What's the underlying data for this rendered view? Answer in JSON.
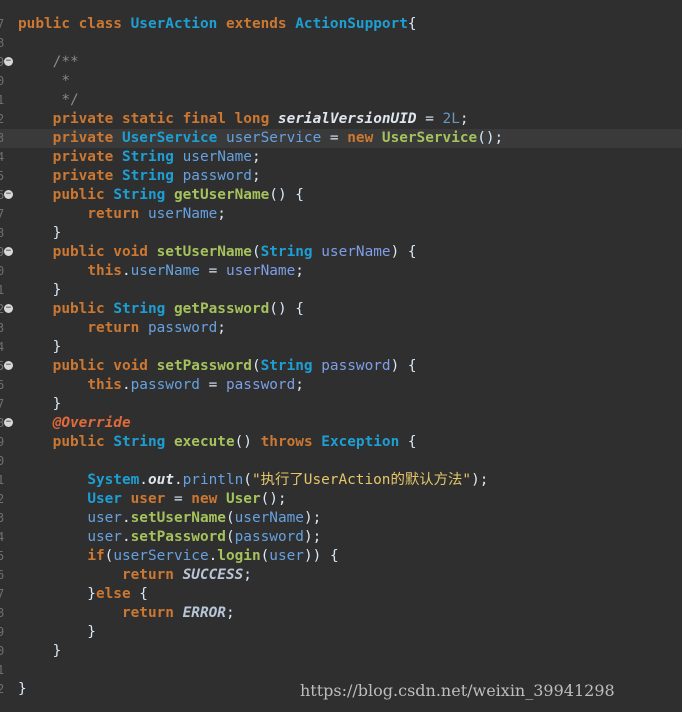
{
  "editor": {
    "lines": [
      {
        "ln": "7",
        "fold": false,
        "hl": false,
        "t": [
          [
            "kw",
            "public class "
          ],
          [
            "ty",
            "UserAction "
          ],
          [
            "kw",
            "extends "
          ],
          [
            "ty",
            "ActionSupport"
          ],
          [
            "pl",
            "{"
          ]
        ]
      },
      {
        "ln": "8",
        "fold": false,
        "hl": false,
        "t": []
      },
      {
        "ln": "9",
        "fold": true,
        "hl": false,
        "t": [
          [
            "pl",
            "    "
          ],
          [
            "cm",
            "/**"
          ]
        ]
      },
      {
        "ln": "0",
        "fold": false,
        "hl": false,
        "t": [
          [
            "pl",
            "    "
          ],
          [
            "cm",
            " *"
          ]
        ]
      },
      {
        "ln": "1",
        "fold": false,
        "hl": false,
        "t": [
          [
            "pl",
            "    "
          ],
          [
            "cm",
            " */"
          ]
        ]
      },
      {
        "ln": "2",
        "fold": false,
        "hl": false,
        "t": [
          [
            "pl",
            "    "
          ],
          [
            "kw",
            "private static final long "
          ],
          [
            "sti",
            "serialVersionUID"
          ],
          [
            "pl",
            " = "
          ],
          [
            "num",
            "2L"
          ],
          [
            "pl",
            ";"
          ]
        ]
      },
      {
        "ln": "3",
        "fold": false,
        "hl": true,
        "t": [
          [
            "pl",
            "    "
          ],
          [
            "kw",
            "private "
          ],
          [
            "ty",
            "UserService "
          ],
          [
            "fld",
            "userService"
          ],
          [
            "pl",
            " = "
          ],
          [
            "kw",
            "new "
          ],
          [
            "fn",
            "UserService"
          ],
          [
            "pl",
            "();"
          ]
        ]
      },
      {
        "ln": "4",
        "fold": false,
        "hl": false,
        "t": [
          [
            "pl",
            "    "
          ],
          [
            "kw",
            "private "
          ],
          [
            "ty",
            "String "
          ],
          [
            "fld",
            "userName"
          ],
          [
            "pl",
            ";"
          ]
        ]
      },
      {
        "ln": "5",
        "fold": false,
        "hl": false,
        "t": [
          [
            "pl",
            "    "
          ],
          [
            "kw",
            "private "
          ],
          [
            "ty",
            "String "
          ],
          [
            "fld",
            "password"
          ],
          [
            "pl",
            ";"
          ]
        ]
      },
      {
        "ln": "6",
        "fold": true,
        "hl": false,
        "t": [
          [
            "pl",
            "    "
          ],
          [
            "kw",
            "public "
          ],
          [
            "ty",
            "String "
          ],
          [
            "fn",
            "getUserName"
          ],
          [
            "pl",
            "() {"
          ]
        ]
      },
      {
        "ln": "7",
        "fold": false,
        "hl": false,
        "t": [
          [
            "pl",
            "        "
          ],
          [
            "kw",
            "return "
          ],
          [
            "fld",
            "userName"
          ],
          [
            "pl",
            ";"
          ]
        ]
      },
      {
        "ln": "8",
        "fold": false,
        "hl": false,
        "t": [
          [
            "pl",
            "    }"
          ]
        ]
      },
      {
        "ln": "9",
        "fold": true,
        "hl": false,
        "t": [
          [
            "pl",
            "    "
          ],
          [
            "kw",
            "public void "
          ],
          [
            "fn",
            "setUserName"
          ],
          [
            "pl",
            "("
          ],
          [
            "ty",
            "String "
          ],
          [
            "prm",
            "userName"
          ],
          [
            "pl",
            ") {"
          ]
        ]
      },
      {
        "ln": "0",
        "fold": false,
        "hl": false,
        "t": [
          [
            "pl",
            "        "
          ],
          [
            "kw",
            "this"
          ],
          [
            "pl",
            "."
          ],
          [
            "fld",
            "userName"
          ],
          [
            "pl",
            " = "
          ],
          [
            "prm",
            "userName"
          ],
          [
            "pl",
            ";"
          ]
        ]
      },
      {
        "ln": "1",
        "fold": false,
        "hl": false,
        "t": [
          [
            "pl",
            "    }"
          ]
        ]
      },
      {
        "ln": "2",
        "fold": true,
        "hl": false,
        "t": [
          [
            "pl",
            "    "
          ],
          [
            "kw",
            "public "
          ],
          [
            "ty",
            "String "
          ],
          [
            "fn",
            "getPassword"
          ],
          [
            "pl",
            "() {"
          ]
        ]
      },
      {
        "ln": "3",
        "fold": false,
        "hl": false,
        "t": [
          [
            "pl",
            "        "
          ],
          [
            "kw",
            "return "
          ],
          [
            "fld",
            "password"
          ],
          [
            "pl",
            ";"
          ]
        ]
      },
      {
        "ln": "4",
        "fold": false,
        "hl": false,
        "t": [
          [
            "pl",
            "    }"
          ]
        ]
      },
      {
        "ln": "5",
        "fold": true,
        "hl": false,
        "t": [
          [
            "pl",
            "    "
          ],
          [
            "kw",
            "public void "
          ],
          [
            "fn",
            "setPassword"
          ],
          [
            "pl",
            "("
          ],
          [
            "ty",
            "String "
          ],
          [
            "prm",
            "password"
          ],
          [
            "pl",
            ") {"
          ]
        ]
      },
      {
        "ln": "6",
        "fold": false,
        "hl": false,
        "t": [
          [
            "pl",
            "        "
          ],
          [
            "kw",
            "this"
          ],
          [
            "pl",
            "."
          ],
          [
            "fld",
            "password"
          ],
          [
            "pl",
            " = "
          ],
          [
            "prm",
            "password"
          ],
          [
            "pl",
            ";"
          ]
        ]
      },
      {
        "ln": "7",
        "fold": false,
        "hl": false,
        "t": [
          [
            "pl",
            "    }"
          ]
        ]
      },
      {
        "ln": "8",
        "fold": true,
        "hl": false,
        "t": [
          [
            "pl",
            "    "
          ],
          [
            "an",
            "@Override"
          ]
        ]
      },
      {
        "ln": "9",
        "fold": false,
        "hl": false,
        "t": [
          [
            "pl",
            "    "
          ],
          [
            "kw",
            "public "
          ],
          [
            "ty",
            "String "
          ],
          [
            "fn",
            "execute"
          ],
          [
            "pl",
            "() "
          ],
          [
            "kw",
            "throws "
          ],
          [
            "ty",
            "Exception"
          ],
          [
            "pl",
            " {"
          ]
        ]
      },
      {
        "ln": "0",
        "fold": false,
        "hl": false,
        "t": []
      },
      {
        "ln": "1",
        "fold": false,
        "hl": false,
        "t": [
          [
            "pl",
            "        "
          ],
          [
            "ty",
            "System"
          ],
          [
            "pl",
            "."
          ],
          [
            "sti",
            "out"
          ],
          [
            "pl",
            "."
          ],
          [
            "fld",
            "println"
          ],
          [
            "pl",
            "("
          ],
          [
            "str",
            "\"执行了UserAction的默认方法\""
          ],
          [
            "pl",
            ");"
          ]
        ]
      },
      {
        "ln": "2",
        "fold": false,
        "hl": false,
        "t": [
          [
            "pl",
            "        "
          ],
          [
            "ty",
            "User "
          ],
          [
            "kw",
            "user"
          ],
          [
            "pl",
            " = "
          ],
          [
            "kw",
            "new "
          ],
          [
            "fn",
            "User"
          ],
          [
            "pl",
            "();"
          ]
        ]
      },
      {
        "ln": "3",
        "fold": false,
        "hl": false,
        "t": [
          [
            "pl",
            "        "
          ],
          [
            "fld",
            "user"
          ],
          [
            "pl",
            "."
          ],
          [
            "fn",
            "setUserName"
          ],
          [
            "pl",
            "("
          ],
          [
            "fld",
            "userName"
          ],
          [
            "pl",
            ");"
          ]
        ]
      },
      {
        "ln": "4",
        "fold": false,
        "hl": false,
        "t": [
          [
            "pl",
            "        "
          ],
          [
            "fld",
            "user"
          ],
          [
            "pl",
            "."
          ],
          [
            "fn",
            "setPassword"
          ],
          [
            "pl",
            "("
          ],
          [
            "fld",
            "password"
          ],
          [
            "pl",
            ");"
          ]
        ]
      },
      {
        "ln": "5",
        "fold": false,
        "hl": false,
        "t": [
          [
            "pl",
            "        "
          ],
          [
            "kw",
            "if"
          ],
          [
            "pl",
            "("
          ],
          [
            "fld",
            "userService"
          ],
          [
            "pl",
            "."
          ],
          [
            "fn",
            "login"
          ],
          [
            "pl",
            "("
          ],
          [
            "fld",
            "user"
          ],
          [
            "pl",
            ")) {"
          ]
        ]
      },
      {
        "ln": "6",
        "fold": false,
        "hl": false,
        "t": [
          [
            "pl",
            "            "
          ],
          [
            "kw",
            "return "
          ],
          [
            "cn",
            "SUCCESS"
          ],
          [
            "pl",
            ";"
          ]
        ]
      },
      {
        "ln": "7",
        "fold": false,
        "hl": false,
        "t": [
          [
            "pl",
            "        }"
          ],
          [
            "kw",
            "else"
          ],
          [
            "pl",
            " {"
          ]
        ]
      },
      {
        "ln": "8",
        "fold": false,
        "hl": false,
        "t": [
          [
            "pl",
            "            "
          ],
          [
            "kw",
            "return "
          ],
          [
            "cn",
            "ERROR"
          ],
          [
            "pl",
            ";"
          ]
        ]
      },
      {
        "ln": "9",
        "fold": false,
        "hl": false,
        "t": [
          [
            "pl",
            "        }"
          ]
        ]
      },
      {
        "ln": "0",
        "fold": false,
        "hl": false,
        "t": [
          [
            "pl",
            "    }"
          ]
        ]
      },
      {
        "ln": "1",
        "fold": false,
        "hl": false,
        "t": []
      },
      {
        "ln": "2",
        "fold": false,
        "hl": false,
        "t": [
          [
            "pl",
            "}"
          ]
        ]
      }
    ]
  },
  "watermark": "https://blog.csdn.net/weixin_39941298"
}
